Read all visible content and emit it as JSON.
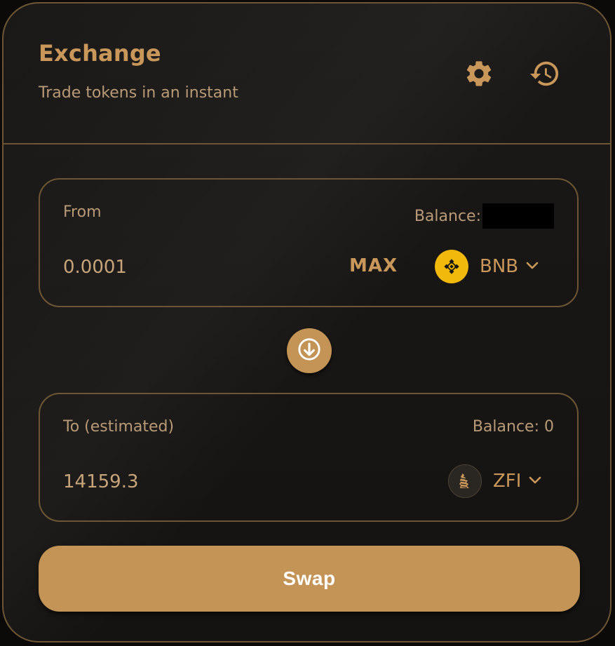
{
  "header": {
    "title": "Exchange",
    "subtitle": "Trade tokens in an instant",
    "settings_icon": "gear-icon",
    "history_icon": "history-icon"
  },
  "from": {
    "label": "From",
    "balance_label": "Balance:",
    "amount": "0.0001",
    "max_label": "MAX",
    "token": {
      "symbol": "BNB",
      "icon": "bnb-logo-icon"
    }
  },
  "switch": {
    "icon": "arrow-down-icon"
  },
  "to": {
    "label": "To (estimated)",
    "balance_label": "Balance: 0",
    "amount": "14159.3",
    "token": {
      "symbol": "ZFI",
      "icon": "zfi-logo-icon"
    }
  },
  "swap_button": {
    "label": "Swap"
  },
  "colors": {
    "accent": "#c9975a",
    "button_bg": "#c39455",
    "border": "#6e5634",
    "text_muted": "#b89a77",
    "bnb_yellow": "#f0b90b"
  }
}
